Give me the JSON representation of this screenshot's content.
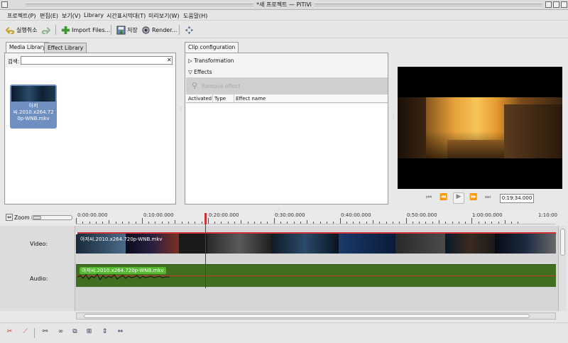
{
  "window": {
    "title": "*새 프로젝트 — PiTiVi"
  },
  "menu": [
    "프로젝트(P)",
    "편집(E)",
    "보기(V)",
    "Library",
    "시간표시막대(T)",
    "미리보기(W)",
    "도움말(H)"
  ],
  "toolbar": {
    "undo_label": "실행취소",
    "import_label": "Import Files...",
    "save_label": "저장",
    "render_label": "Render..."
  },
  "media_library": {
    "tabs": [
      "Media Library",
      "Effect Library"
    ],
    "search_label": "검색:",
    "search_value": "",
    "clip_name": "아저씨.2010.x264.720p-WNB.mkv",
    "clip_name_display": "아저\n씨.2010.x264.72\n0p-WNB.mkv"
  },
  "clip_config": {
    "tab": "Clip configuration",
    "transformation_label": "Transformation",
    "effects_label": "Effects",
    "remove_label": "Remove effect",
    "col_activated": "Activated",
    "col_type": "Type",
    "col_effect_name": "Effect name"
  },
  "viewer": {
    "timecode": "0:19:34.000"
  },
  "timeline": {
    "zoom_label": "Zoom",
    "ruler": [
      "0:00:00.000",
      "0:10:00.000",
      "0:20:00.000",
      "0:30:00.000",
      "0:40:00.000",
      "0:50:00.000",
      "1:00:00.000",
      "1:10:00"
    ],
    "video_label": "Video:",
    "audio_label": "Audio:",
    "video_clip": "아저씨.2010.x264.720p-WNB.mkv",
    "audio_clip": "아저씨.2010.x264.720p-WNB.mkv"
  },
  "colors": {
    "selection": "#6f8fc0",
    "audio_track": "#3f6f1f",
    "audio_label": "#55b830",
    "playhead_marker": "#cc3333"
  }
}
